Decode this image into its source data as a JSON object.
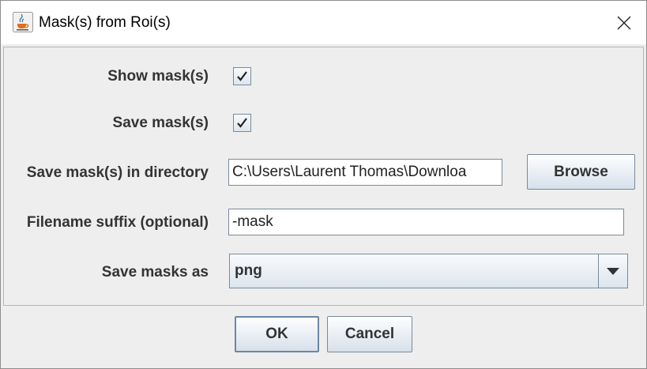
{
  "window": {
    "title": "Mask(s) from Roi(s)"
  },
  "form": {
    "show_masks_label": "Show mask(s)",
    "show_masks_checked": true,
    "save_masks_label": "Save mask(s)",
    "save_masks_checked": true,
    "directory_label": "Save mask(s) in directory",
    "directory_value": "C:\\Users\\Laurent Thomas\\Downloa",
    "browse_label": "Browse",
    "suffix_label": "Filename suffix (optional)",
    "suffix_value": "-mask",
    "format_label": "Save masks as",
    "format_value": "png"
  },
  "buttons": {
    "ok_label": "OK",
    "cancel_label": "Cancel"
  },
  "icons": {
    "app": "java-coffee-cup-icon",
    "close": "close-icon",
    "check": "check-icon",
    "dropdown": "triangle-down-icon"
  }
}
